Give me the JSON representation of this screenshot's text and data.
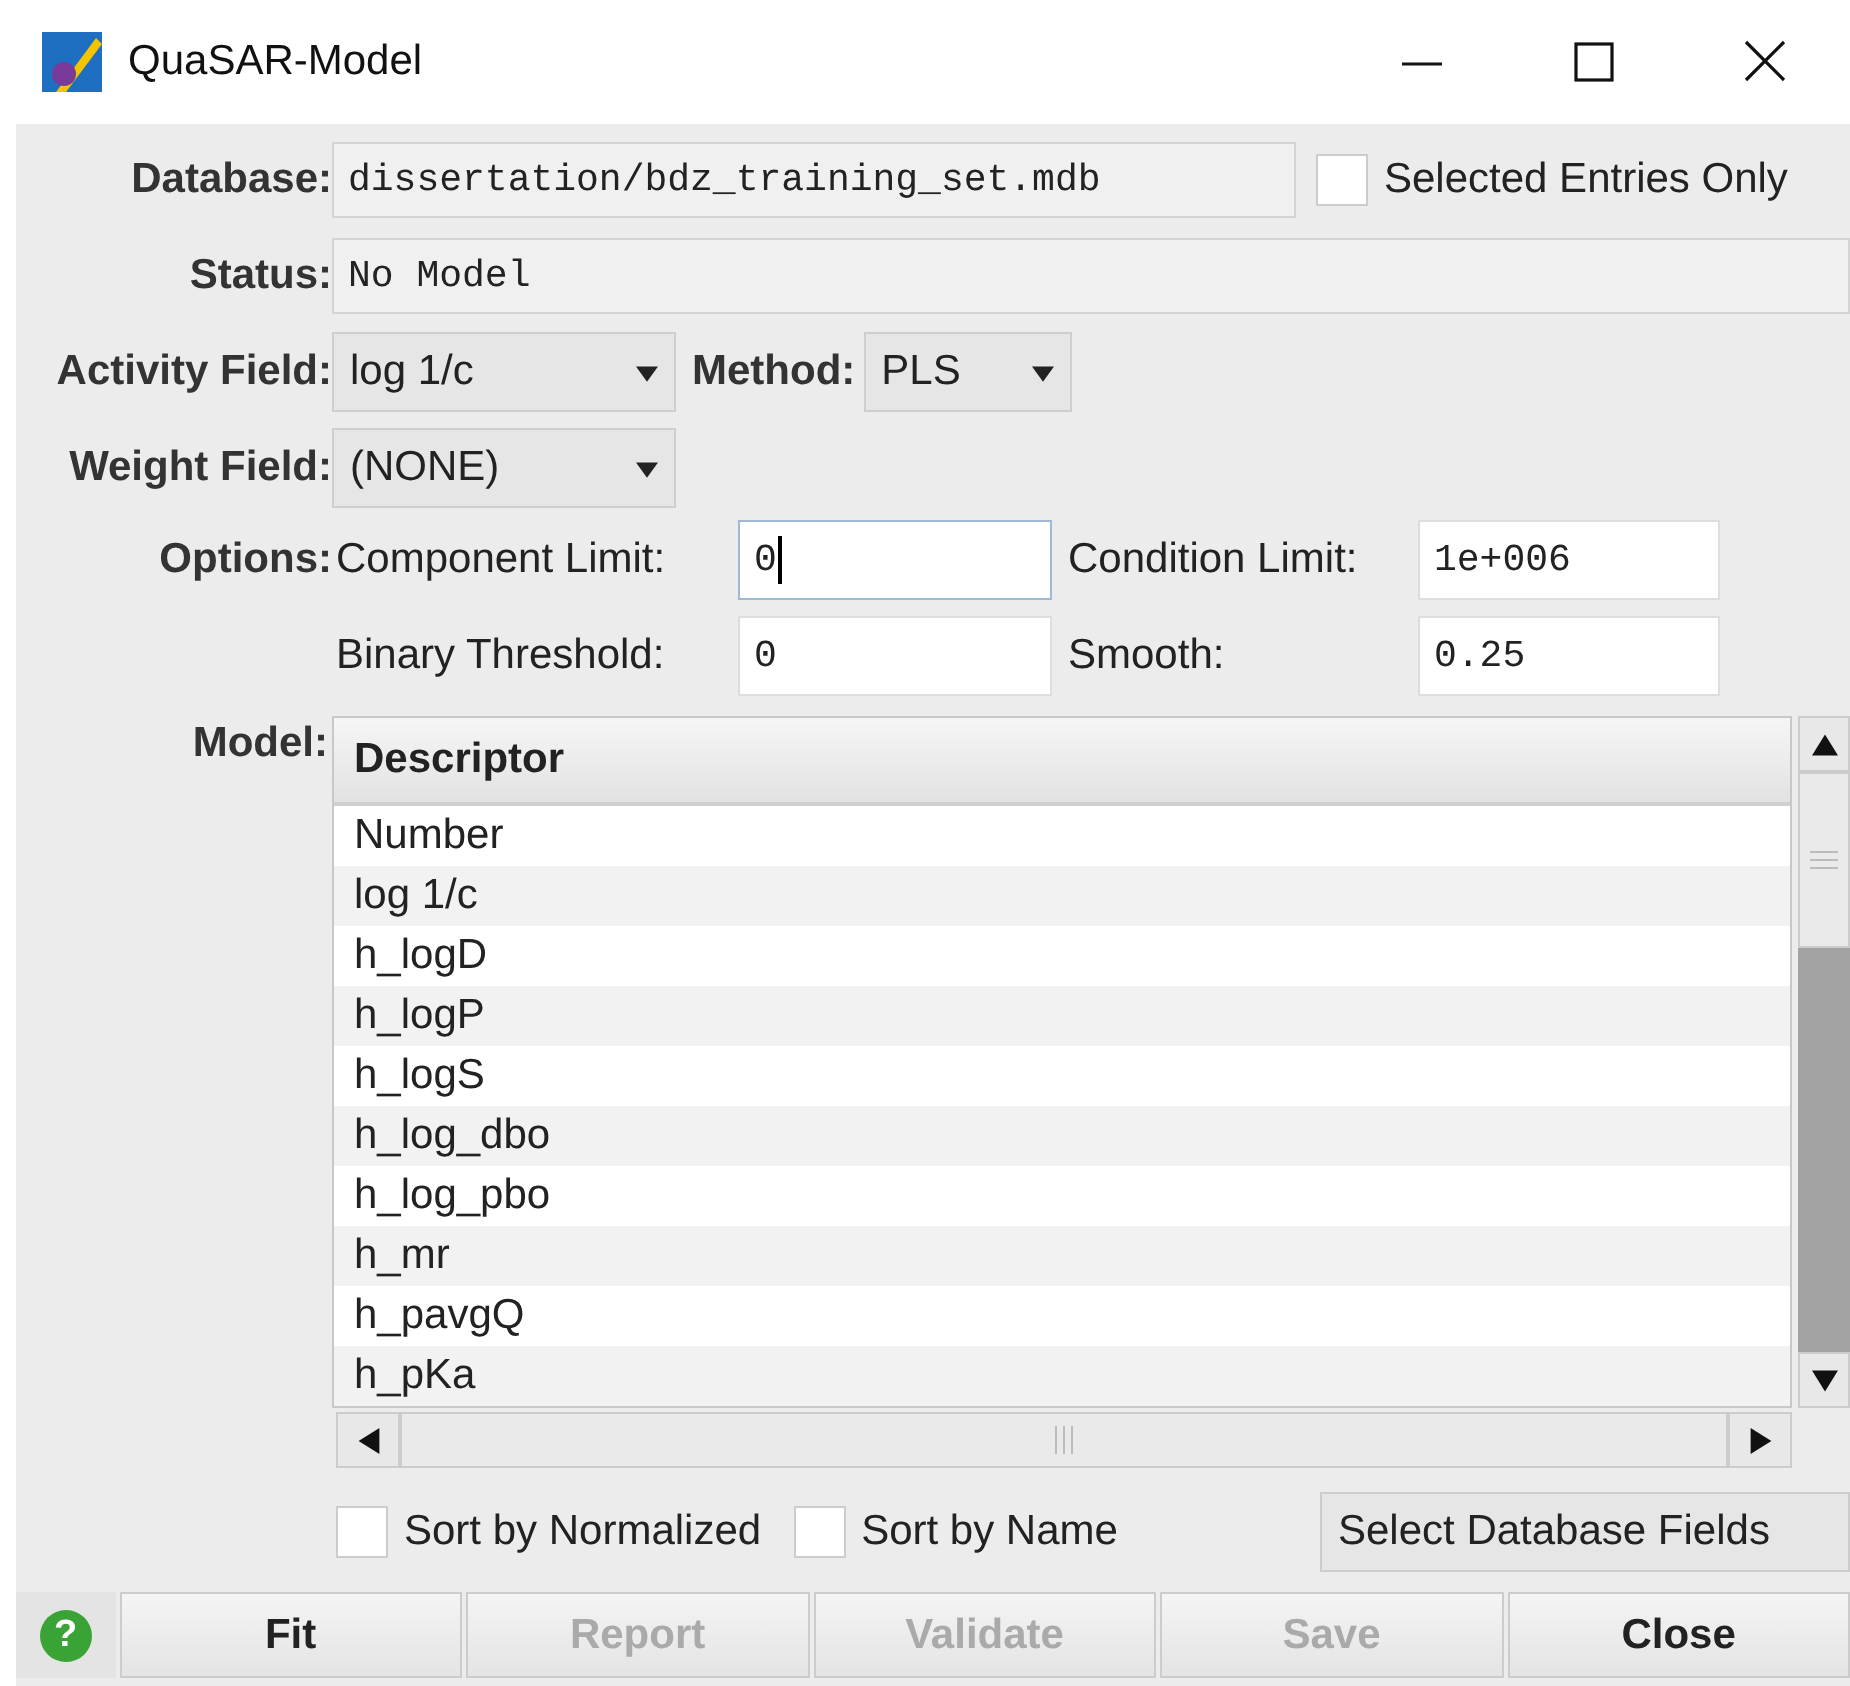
{
  "window": {
    "title": "QuaSAR-Model"
  },
  "database": {
    "label": "Database:",
    "value": "dissertation/bdz_training_set.mdb"
  },
  "selected_entries_only": {
    "label": "Selected Entries Only",
    "checked": false
  },
  "status": {
    "label": "Status:",
    "value": "No Model"
  },
  "activity_field": {
    "label": "Activity Field:",
    "value": "log 1/c"
  },
  "method": {
    "label": "Method:",
    "value": "PLS"
  },
  "weight_field": {
    "label": "Weight Field:",
    "value": "(NONE)"
  },
  "options": {
    "label": "Options:",
    "fields": [
      {
        "label": "Component Limit:",
        "value": "0",
        "focused": true
      },
      {
        "label": "Condition Limit:",
        "value": "1e+006",
        "focused": false
      },
      {
        "label": "Binary Threshold:",
        "value": "0",
        "focused": false
      },
      {
        "label": "Smooth:",
        "value": "0.25",
        "focused": false
      }
    ]
  },
  "model": {
    "label": "Model:",
    "columns": [
      "Descriptor"
    ],
    "rows": [
      "Number",
      "log 1/c",
      "h_logD",
      "h_logP",
      "h_logS",
      "h_log_dbo",
      "h_log_pbo",
      "h_mr",
      "h_pavgQ",
      "h_pKa"
    ]
  },
  "sort_options": [
    {
      "label": "Sort by Normalized",
      "checked": false
    },
    {
      "label": "Sort by Name",
      "checked": false
    }
  ],
  "select_fields_button": "Select Database Fields",
  "help": "?",
  "buttons": [
    {
      "label": "Fit",
      "disabled": false
    },
    {
      "label": "Report",
      "disabled": true
    },
    {
      "label": "Validate",
      "disabled": true
    },
    {
      "label": "Save",
      "disabled": true
    },
    {
      "label": "Close",
      "disabled": false
    }
  ]
}
